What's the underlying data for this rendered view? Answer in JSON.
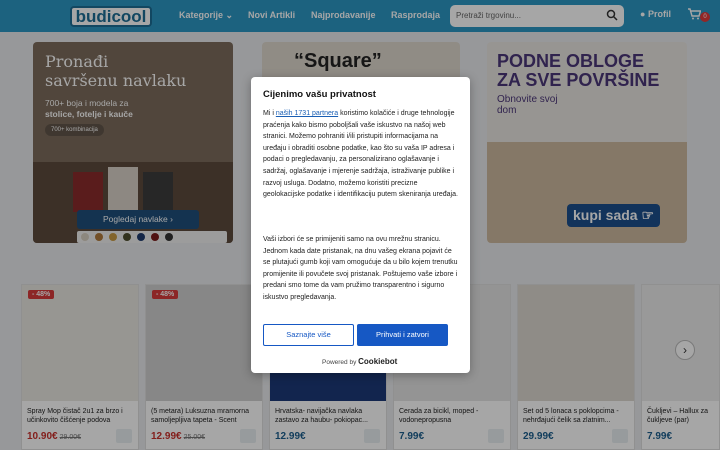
{
  "header": {
    "logo": "budicool",
    "nav": [
      "Kategorije",
      "Novi Artikli",
      "Najprodavanije",
      "Rasprodaja"
    ],
    "search_placeholder": "Pretraži trgovinu...",
    "profile": "Profil",
    "cart_count": "0"
  },
  "banners": {
    "b1_title1": "Pronađi",
    "b1_title2": "savršenu navlaku",
    "b1_sub1": "700+ boja i modela za",
    "b1_sub2": "stolice, fotelje i kauče",
    "b1_chip": "700+ kombinacija",
    "b1_button": "Pogledaj navlake",
    "b2_title": "“Square”",
    "b3_title1": "PODNE OBLOGE",
    "b3_title2": "ZA SVE POVRŠINE",
    "b3_sub1": "Obnovite svoj",
    "b3_sub2": "dom",
    "b3_button": "kupi sada"
  },
  "products": [
    {
      "title": "Spray Mop čistač 2u1 za brzo i učinkovito čišćenje podova",
      "price": "10.90€",
      "old": "29.00€",
      "discount": "- 48%"
    },
    {
      "title": "(5 metara) Luksuzna mramorna samoljepljiva tapeta - Scent",
      "price": "12.99€",
      "old": "25.00€",
      "discount": "- 48%"
    },
    {
      "title": "Hrvatska- navijačka navlaka zastavo za haubu- pokiopac...",
      "price": "12.99€",
      "old": "",
      "discount": ""
    },
    {
      "title": "Cerada za bicikl, moped - vodonepropusna",
      "price": "7.99€",
      "old": "",
      "discount": ""
    },
    {
      "title": "Set od 5 lonaca s poklopcima - nehrđajući čelik sa zlatnim...",
      "price": "29.99€",
      "old": "",
      "discount": ""
    },
    {
      "title": "Čukljevi – Hallux za čukljeve (par)",
      "price": "7.99€",
      "old": "",
      "discount": ""
    }
  ],
  "cookie": {
    "title": "Cijenimo vašu privatnost",
    "p1_pre": "Mi i ",
    "p1_link": "naših 1731 partnera",
    "p1_post": " koristimo kolačiće i druge tehnologije praćenja kako bismo poboljšali vaše iskustvo na našoj web stranici. Možemo pohraniti i/ili pristupiti informacijama na uređaju i obraditi osobne podatke, kao što su vaša IP adresa i podaci o pregledavanju, za personalizirano oglašavanje i sadržaj, oglašavanje i mjerenje sadržaja, istraživanje publike i razvoj usluga. Dodatno, možemo koristiti precizne geolokacijske podatke i identifikaciju putem skeniranja uređaja.",
    "p2": "Vaši izbori će se primijeniti samo na ovu mrežnu stranicu. Jednom kada date pristanak, na dnu vašeg ekrana pojavit će se plutajući gumb koji vam omogućuje da u bilo kojem trenutku promijenite ili povučete svoj pristanak. Poštujemo vaše izbore i predani smo tome da vam pružimo transparentno i sigurno iskustvo pregledavanja.",
    "btn_more": "Saznajte više",
    "btn_accept": "Prihvati i zatvori",
    "powered": "Powered by",
    "brand": "Cookiebot"
  }
}
